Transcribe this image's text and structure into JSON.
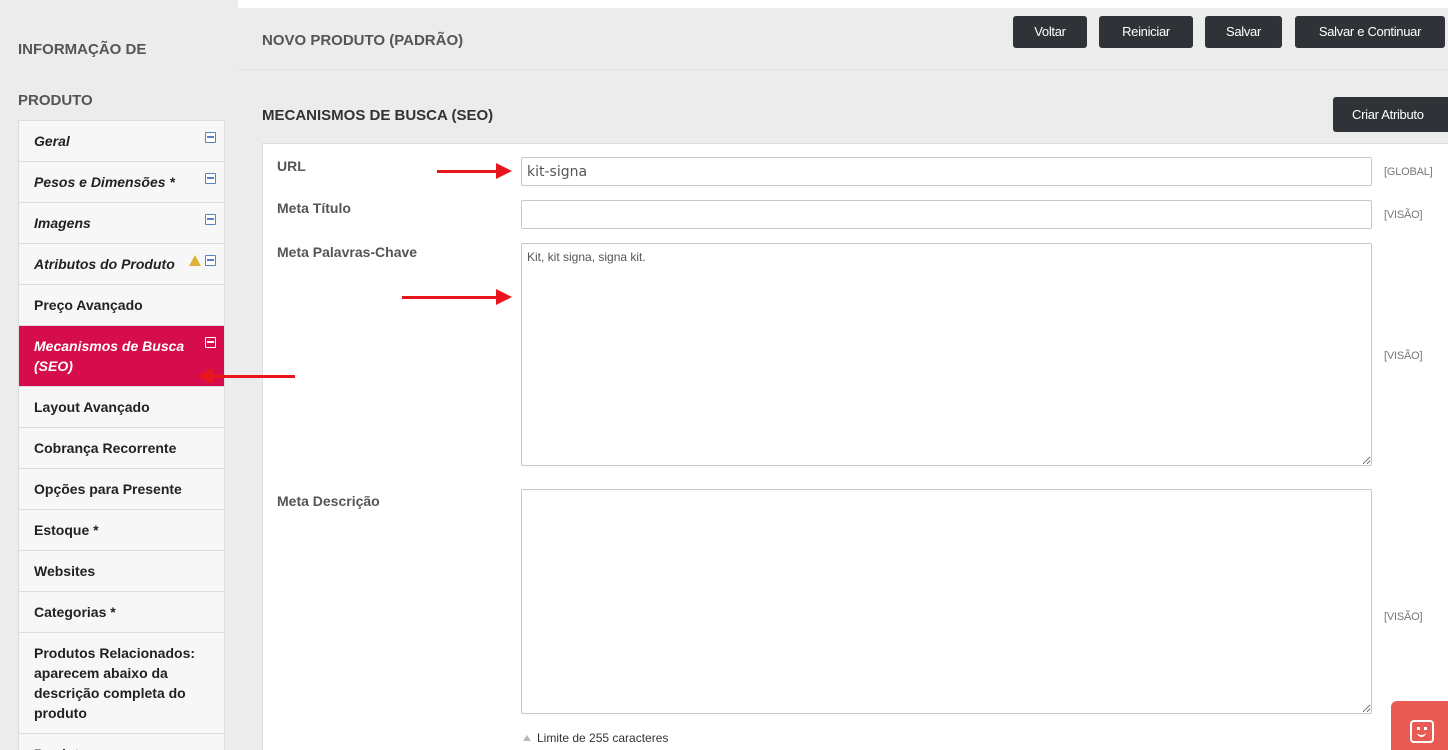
{
  "sidebar": {
    "title": "Informação de Produto",
    "tabs": [
      {
        "label": "Geral",
        "italic": true,
        "save_icon": true,
        "warning_icon": false,
        "active": false
      },
      {
        "label": "Pesos e Dimensões *",
        "italic": true,
        "save_icon": true,
        "warning_icon": false,
        "active": false
      },
      {
        "label": "Imagens",
        "italic": true,
        "save_icon": true,
        "warning_icon": false,
        "active": false
      },
      {
        "label": "Atributos do Produto",
        "italic": true,
        "save_icon": true,
        "warning_icon": true,
        "active": false
      },
      {
        "label": "Preço Avançado",
        "italic": false,
        "save_icon": false,
        "warning_icon": false,
        "active": false
      },
      {
        "label": "Mecanismos de Busca (SEO)",
        "italic": true,
        "save_icon": true,
        "warning_icon": false,
        "active": true
      },
      {
        "label": "Layout Avançado",
        "italic": false,
        "save_icon": false,
        "warning_icon": false,
        "active": false
      },
      {
        "label": "Cobrança Recorrente",
        "italic": false,
        "save_icon": false,
        "warning_icon": false,
        "active": false
      },
      {
        "label": "Opções para Presente",
        "italic": false,
        "save_icon": false,
        "warning_icon": false,
        "active": false
      },
      {
        "label": "Estoque *",
        "italic": false,
        "save_icon": false,
        "warning_icon": false,
        "active": false
      },
      {
        "label": "Websites",
        "italic": false,
        "save_icon": false,
        "warning_icon": false,
        "active": false
      },
      {
        "label": "Categorias *",
        "italic": false,
        "save_icon": false,
        "warning_icon": false,
        "active": false
      },
      {
        "label": "Produtos Relacionados: aparecem abaixo da descrição completa do produto",
        "italic": false,
        "save_icon": false,
        "warning_icon": false,
        "active": false
      },
      {
        "label": "Produtos",
        "italic": false,
        "save_icon": false,
        "warning_icon": false,
        "active": false
      }
    ]
  },
  "header": {
    "title": "NOVO PRODUTO (PADRÃO)",
    "buttons": {
      "back": "Voltar",
      "reset": "Reiniciar",
      "save": "Salvar",
      "save_continue": "Salvar e Continuar"
    }
  },
  "section": {
    "title": "MECANISMOS DE BUSCA (SEO)",
    "create_attribute": "Criar Atributo",
    "fields": {
      "url": {
        "label": "URL",
        "value": "kit-signa",
        "scope": "[GLOBAL]"
      },
      "meta_title": {
        "label": "Meta Título",
        "value": "",
        "scope": "[VISÃO]"
      },
      "meta_keywords": {
        "label": "Meta Palavras-Chave",
        "value": "Kit, kit signa, signa kit.",
        "scope": "[VISÃO]"
      },
      "meta_description": {
        "label": "Meta Descrição",
        "value": "",
        "scope": "[VISÃO]"
      }
    },
    "char_limit_note": "Limite de 255 caracteres"
  },
  "colors": {
    "active_tab": "#d60d4c",
    "button_dark": "#2f3337",
    "annotation_arrow": "#e8161c",
    "chat_widget": "#e85a54",
    "save_icon": "#5e7fbf",
    "warning_icon": "#e0b237"
  },
  "icons": {
    "tab_save": "save-icon",
    "tab_warning": "warning-icon",
    "char_limit": "triangle-up-icon",
    "chat": "chat-icon"
  }
}
